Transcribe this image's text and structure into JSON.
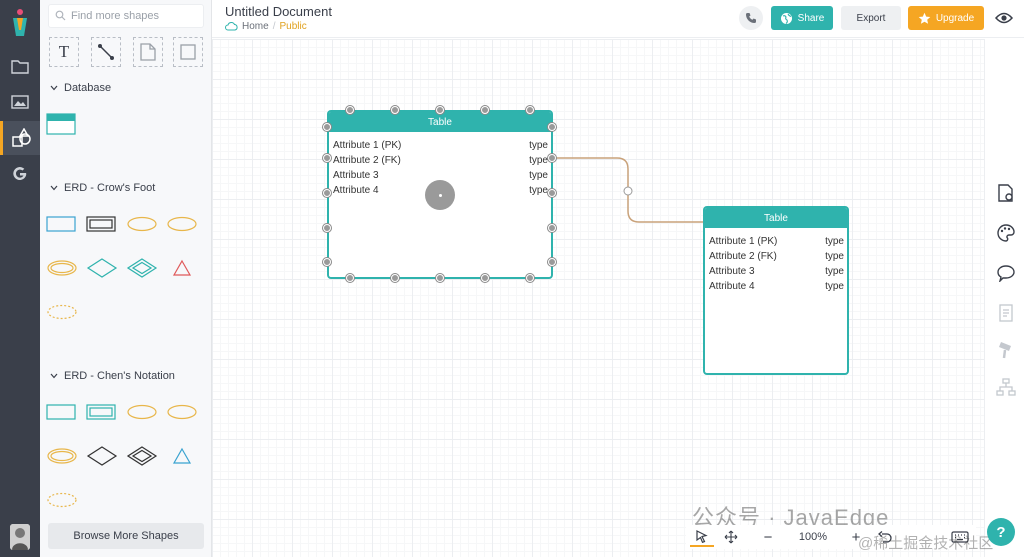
{
  "header": {
    "doc_title": "Untitled Document",
    "breadcrumb_home": "Home",
    "breadcrumb_separator": "/",
    "breadcrumb_visibility": "Public",
    "share_label": "Share",
    "export_label": "Export",
    "upgrade_label": "Upgrade"
  },
  "panel": {
    "search_placeholder": "Find more shapes",
    "sections": [
      {
        "title": "Database"
      },
      {
        "title": "ERD - Crow's Foot"
      },
      {
        "title": "ERD - Chen's Notation"
      }
    ],
    "browse_label": "Browse More Shapes",
    "tool_text_glyph": "T"
  },
  "tables": [
    {
      "header": "Table",
      "rows": [
        {
          "name": "Attribute 1 (PK)",
          "type": "type"
        },
        {
          "name": "Attribute 2 (FK)",
          "type": "type"
        },
        {
          "name": "Attribute 3",
          "type": "type"
        },
        {
          "name": "Attribute 4",
          "type": "type"
        }
      ]
    },
    {
      "header": "Table",
      "rows": [
        {
          "name": "Attribute 1 (PK)",
          "type": "type"
        },
        {
          "name": "Attribute 2 (FK)",
          "type": "type"
        },
        {
          "name": "Attribute 3",
          "type": "type"
        },
        {
          "name": "Attribute 4",
          "type": "type"
        }
      ]
    }
  ],
  "bottom": {
    "zoom": "100%",
    "minus": "−",
    "plus": "+"
  },
  "watermark": {
    "line1": "公众号 · JavaEdge",
    "line2": "@稀土掘金技术社区"
  },
  "help_label": "?",
  "colors": {
    "accent": "#2fb3ad",
    "upgrade": "#f5a623",
    "rail": "#3a3f4a",
    "connector": "#c9a27a"
  }
}
